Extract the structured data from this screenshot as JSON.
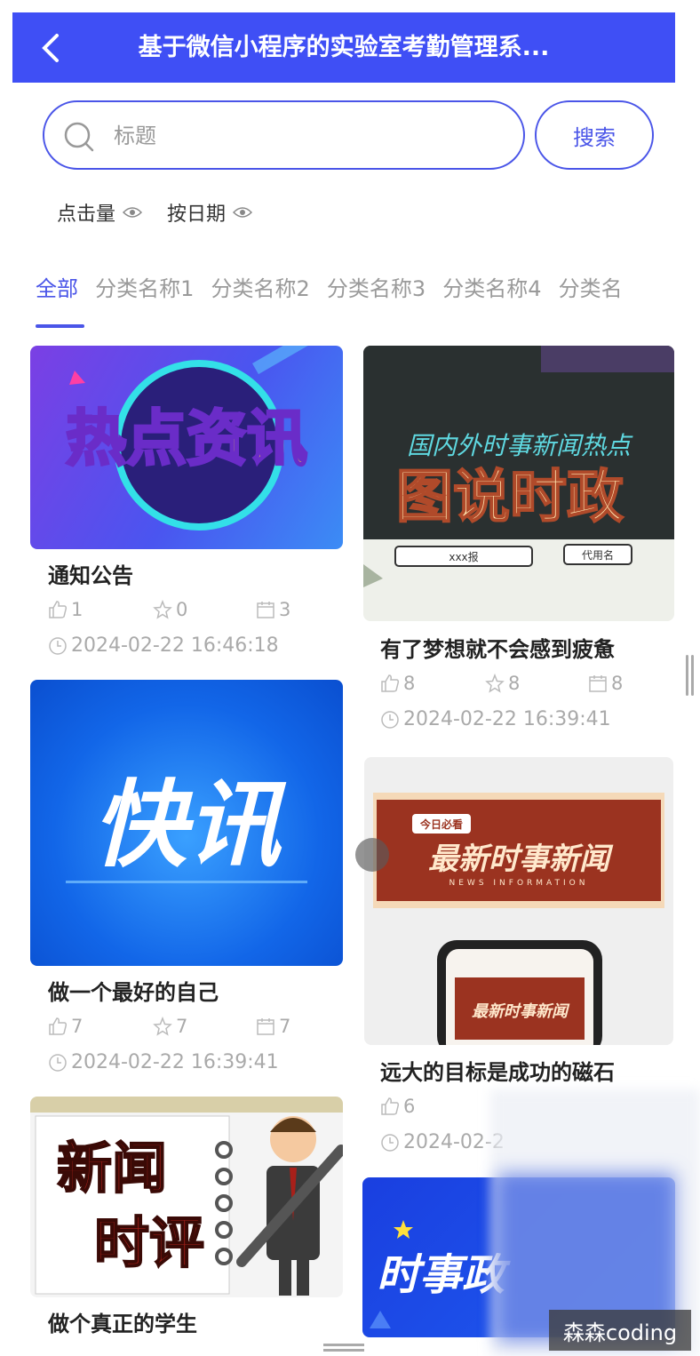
{
  "header": {
    "title": "基于微信小程序的实验室考勤管理系..."
  },
  "search": {
    "placeholder": "标题",
    "button_label": "搜索"
  },
  "sort": {
    "items": [
      {
        "label": "点击量"
      },
      {
        "label": "按日期"
      }
    ]
  },
  "tabs": [
    "全部",
    "分类名称1",
    "分类名称2",
    "分类名称3",
    "分类名称4",
    "分类名"
  ],
  "active_tab": "全部",
  "cards": [
    {
      "image_text": "热点资讯",
      "title": "通知公告",
      "likes": "1",
      "favorites": "0",
      "views": "3",
      "time": "2024-02-22 16:46:18"
    },
    {
      "image_top_text": "国内外时事新闻热点",
      "image_text": "图说时政",
      "image_sub1": "xxx报",
      "image_sub2": "代用名",
      "title": "有了梦想就不会感到疲惫",
      "likes": "8",
      "favorites": "8",
      "views": "8",
      "time": "2024-02-22 16:39:41"
    },
    {
      "image_text": "快讯",
      "title": "做一个最好的自己",
      "likes": "7",
      "favorites": "7",
      "views": "7",
      "time": "2024-02-22 16:39:41"
    },
    {
      "image_badge": "今日必看",
      "image_text": "最新时事新闻",
      "image_sub": "NEWS INFORMATION",
      "image_phone_text": "最新时事新闻",
      "title": "远大的目标是成功的磁石",
      "likes": "6",
      "time": "2024-02-2"
    },
    {
      "image_text_top": "新闻",
      "image_text_bottom": "时评",
      "title": "做个真正的学生"
    },
    {
      "image_text": "时事政"
    }
  ],
  "watermark": "森森coding",
  "colors": {
    "primary": "#3f4ff5",
    "muted": "#aaaaaa"
  }
}
